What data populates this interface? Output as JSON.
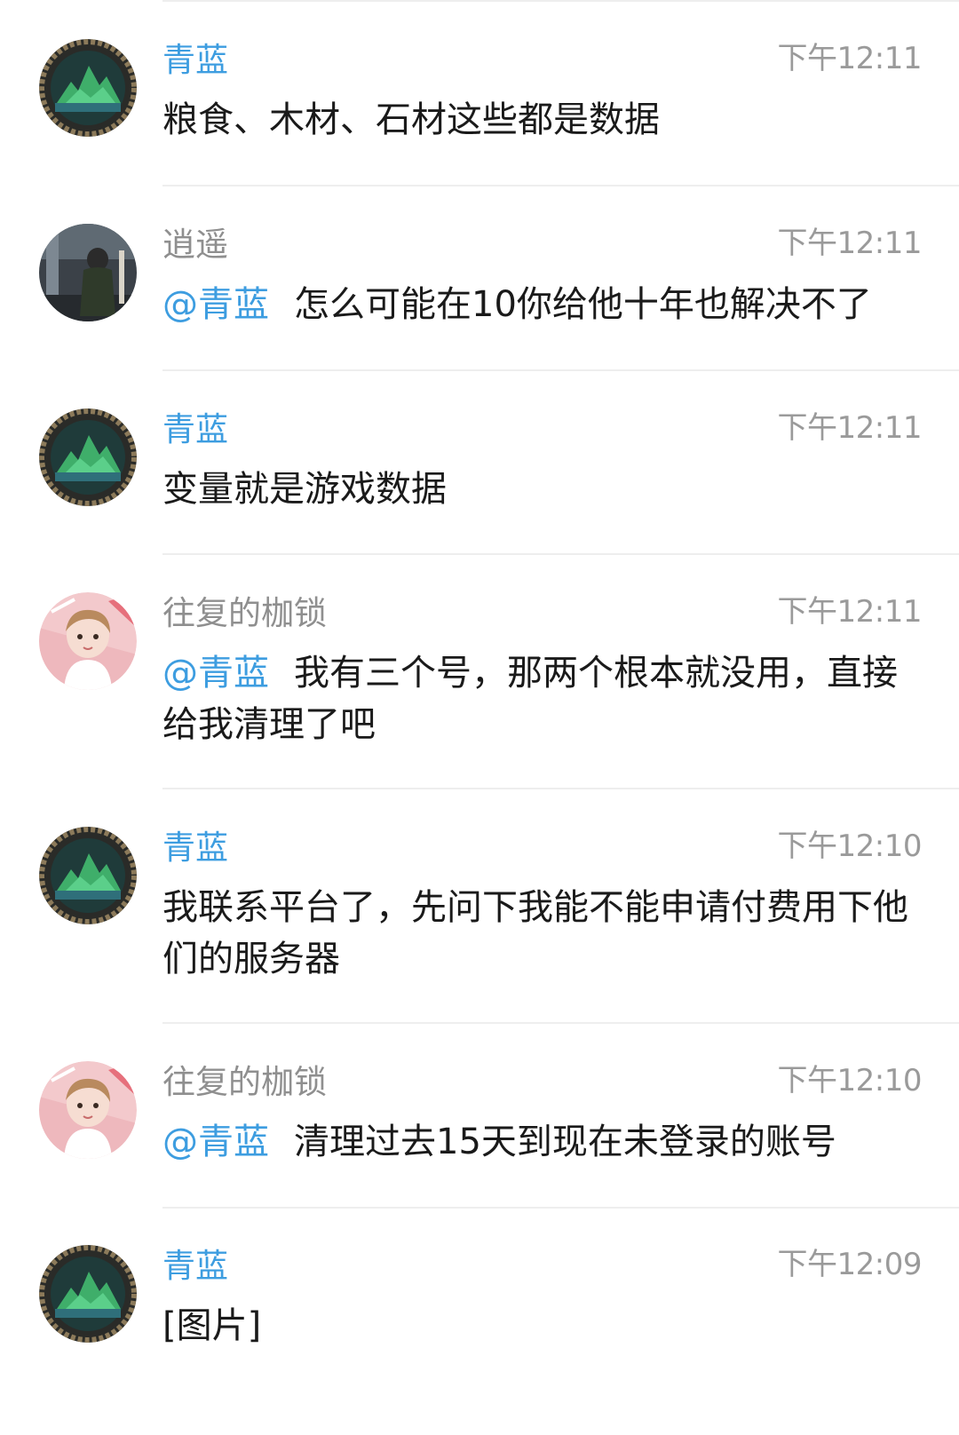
{
  "messages": [
    {
      "sender": "青蓝",
      "self": true,
      "time": "下午12:11",
      "mention": "",
      "text": "粮食、木材、石材这些都是数据",
      "avatar": "landscape-avatar"
    },
    {
      "sender": "逍遥",
      "self": false,
      "time": "下午12:11",
      "mention": "@青蓝",
      "text": "怎么可能在10你给他十年也解决不了",
      "avatar": "night-street-avatar"
    },
    {
      "sender": "青蓝",
      "self": true,
      "time": "下午12:11",
      "mention": "",
      "text": "变量就是游戏数据",
      "avatar": "landscape-avatar"
    },
    {
      "sender": "往复的枷锁",
      "self": false,
      "time": "下午12:11",
      "mention": "@青蓝",
      "text": "我有三个号，那两个根本就没用，直接给我清理了吧",
      "avatar": "cartoon-girl-avatar"
    },
    {
      "sender": "青蓝",
      "self": true,
      "time": "下午12:10",
      "mention": "",
      "text": "我联系平台了，先问下我能不能申请付费用下他们的服务器",
      "avatar": "landscape-avatar"
    },
    {
      "sender": "往复的枷锁",
      "self": false,
      "time": "下午12:10",
      "mention": "@青蓝",
      "text": "清理过去15天到现在未登录的账号",
      "avatar": "cartoon-girl-avatar"
    },
    {
      "sender": "青蓝",
      "self": true,
      "time": "下午12:09",
      "mention": "",
      "text": "[图片]",
      "avatar": "landscape-avatar"
    }
  ],
  "colors": {
    "sender_self": "#3d9de0",
    "sender_other": "#8f8f8f",
    "time": "#9a9a9a",
    "text": "#1a1a1a",
    "divider": "#eeeeee"
  }
}
